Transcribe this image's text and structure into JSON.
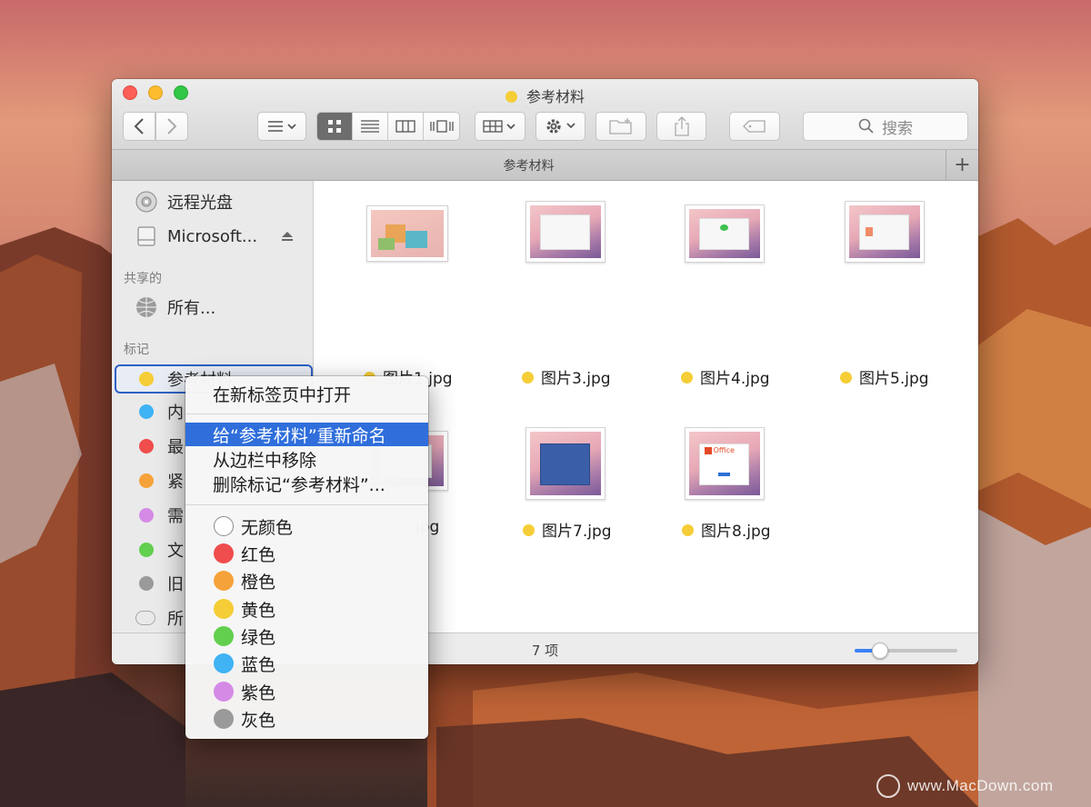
{
  "window": {
    "title": "参考材料",
    "search_placeholder": "搜索",
    "tab_label": "参考材料",
    "tab_add": "+"
  },
  "toolbar": {
    "back": "‹",
    "forward": "›"
  },
  "sidebar": {
    "devices": [
      {
        "label": "远程光盘",
        "icon": "disc-icon"
      },
      {
        "label": "Microsoft...",
        "icon": "drive-icon"
      }
    ],
    "shared_header": "共享的",
    "shared": [
      {
        "label": "所有...",
        "icon": "network-icon"
      }
    ],
    "tags_header": "标记",
    "tags": [
      {
        "label": "参考材料",
        "color": "#f5cd36"
      },
      {
        "label": "内",
        "color": "#3fb3f4"
      },
      {
        "label": "最",
        "color": "#f04d4d"
      },
      {
        "label": "紧",
        "color": "#f6a23a"
      },
      {
        "label": "需",
        "color": "#d58ae6"
      },
      {
        "label": "文",
        "color": "#62cf4e"
      },
      {
        "label": "旧",
        "color": "#9a9a9a"
      },
      {
        "label": "所",
        "color": "#e0e0e0"
      }
    ]
  },
  "files": [
    {
      "name": "图片1.jpg",
      "tag_color": "#f5cd36"
    },
    {
      "name": "图片3.jpg",
      "tag_color": "#f5cd36"
    },
    {
      "name": "图片4.jpg",
      "tag_color": "#f5cd36"
    },
    {
      "name": "图片5.jpg",
      "tag_color": "#f5cd36"
    },
    {
      "name": "jpg",
      "tag_color": "#f5cd36"
    },
    {
      "name": "图片7.jpg",
      "tag_color": "#f5cd36"
    },
    {
      "name": "图片8.jpg",
      "tag_color": "#f5cd36"
    }
  ],
  "thumb_text": {
    "office": "Office"
  },
  "status": {
    "count_text": "7 项",
    "zoom_fraction": 0.25
  },
  "context_menu": {
    "open_in_new_tab": "在新标签页中打开",
    "rename": "给“参考材料”重新命名",
    "remove_from_sidebar": "从边栏中移除",
    "delete_tag": "删除标记“参考材料”...",
    "colors": [
      {
        "label": "无颜色",
        "color": "#ffffff"
      },
      {
        "label": "红色",
        "color": "#f04d4d"
      },
      {
        "label": "橙色",
        "color": "#f6a23a"
      },
      {
        "label": "黄色",
        "color": "#f5cd36"
      },
      {
        "label": "绿色",
        "color": "#62cf4e"
      },
      {
        "label": "蓝色",
        "color": "#3fb3f4"
      },
      {
        "label": "紫色",
        "color": "#d58ae6"
      },
      {
        "label": "灰色",
        "color": "#9a9a9a"
      }
    ]
  },
  "watermark": "www.MacDown.com"
}
